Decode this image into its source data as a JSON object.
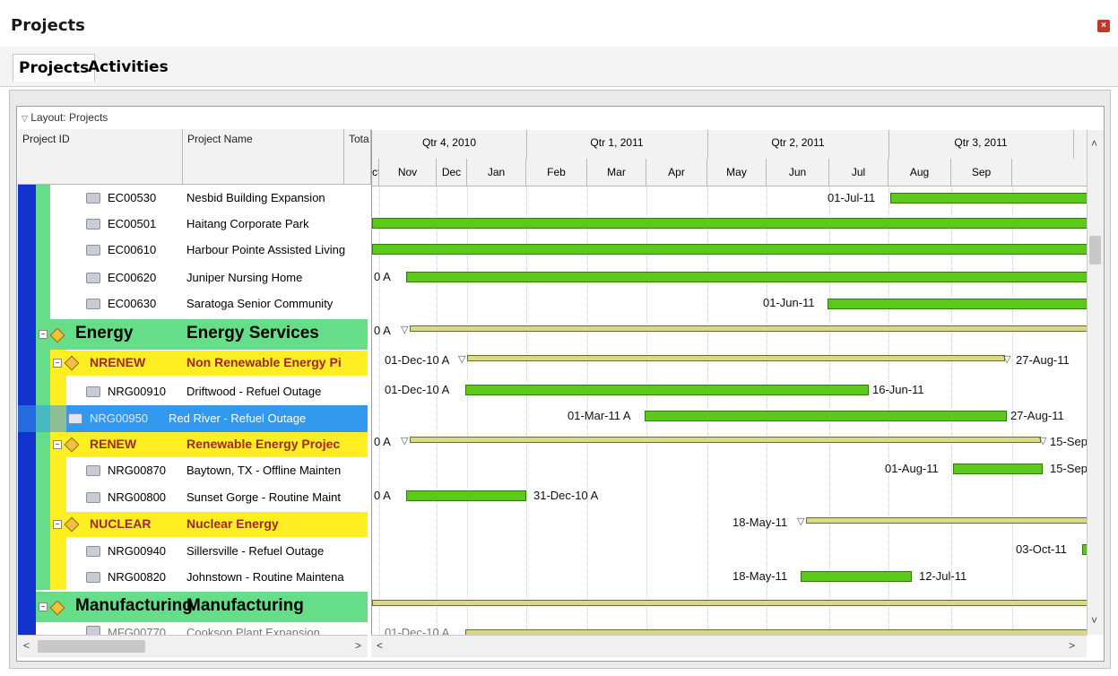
{
  "window": {
    "title": "Projects",
    "close_icon": "close-icon"
  },
  "tabs": [
    "Projects",
    "Activities"
  ],
  "layout_label": "Layout: Projects",
  "columns": {
    "project_id": "Project ID",
    "project_name": "Project Name",
    "total": "Tota"
  },
  "timescale": {
    "quarters": [
      "Qtr 4, 2010",
      "Qtr 1, 2011",
      "Qtr 2, 2011",
      "Qtr 3, 2011"
    ],
    "months": [
      "ct",
      "Nov",
      "Dec",
      "Jan",
      "Feb",
      "Mar",
      "Apr",
      "May",
      "Jun",
      "Jul",
      "Aug",
      "Sep"
    ]
  },
  "rows": [
    {
      "type": "project",
      "id": "EC00530",
      "name": "Nesbid Building Expansion"
    },
    {
      "type": "project",
      "id": "EC00501",
      "name": "Haitang Corporate Park"
    },
    {
      "type": "project",
      "id": "EC00610",
      "name": "Harbour Pointe Assisted Living"
    },
    {
      "type": "project",
      "id": "EC00620",
      "name": "Juniper Nursing Home"
    },
    {
      "type": "project",
      "id": "EC00630",
      "name": "Saratoga Senior Community"
    },
    {
      "type": "eps",
      "id": "Energy",
      "name": "Energy Services",
      "color": "#66dd88"
    },
    {
      "type": "eps",
      "id": "NRENEW",
      "name": "Non Renewable Energy Pi",
      "color": "#ffee22"
    },
    {
      "type": "project",
      "id": "NRG00910",
      "name": "Driftwood - Refuel Outage"
    },
    {
      "type": "project",
      "id": "NRG00950",
      "name": "Red River - Refuel Outage",
      "selected": true
    },
    {
      "type": "eps",
      "id": "RENEW",
      "name": "Renewable Energy Projec",
      "color": "#ffee22"
    },
    {
      "type": "project",
      "id": "NRG00870",
      "name": "Baytown, TX - Offline Mainten"
    },
    {
      "type": "project",
      "id": "NRG00800",
      "name": "Sunset Gorge - Routine Maint"
    },
    {
      "type": "eps",
      "id": "NUCLEAR",
      "name": "Nuclear Energy",
      "color": "#ffee22"
    },
    {
      "type": "project",
      "id": "NRG00940",
      "name": "Sillersville - Refuel Outage"
    },
    {
      "type": "project",
      "id": "NRG00820",
      "name": "Johnstown - Routine Maintena"
    },
    {
      "type": "eps",
      "id": "Manufacturing",
      "name": "Manufacturing",
      "color": "#66dd88"
    },
    {
      "type": "project",
      "id": "MFG00770",
      "name": "Cookson Plant Expansion"
    }
  ],
  "gantt_labels": {
    "r0": "01-Jul-11",
    "r3": "0 A",
    "r4": "01-Jun-11",
    "r5": "0 A",
    "r6_start": "01-Dec-10 A",
    "r6_end": "27-Aug-11",
    "r7_start": "01-Dec-10 A",
    "r7_end": "16-Jun-11",
    "r8_start": "01-Mar-11 A",
    "r8_end": "27-Aug-11",
    "r9_start": "0 A",
    "r9_end": "15-Sep",
    "r10_start": "01-Aug-11",
    "r10_end": "15-Sep",
    "r11_start": "0 A",
    "r11_end": "31-Dec-10 A",
    "r12": "18-May-11",
    "r13": "03-Oct-11",
    "r14_start": "18-May-11",
    "r14_end": "12-Jul-11",
    "r16": "01-Dec-10 A"
  }
}
